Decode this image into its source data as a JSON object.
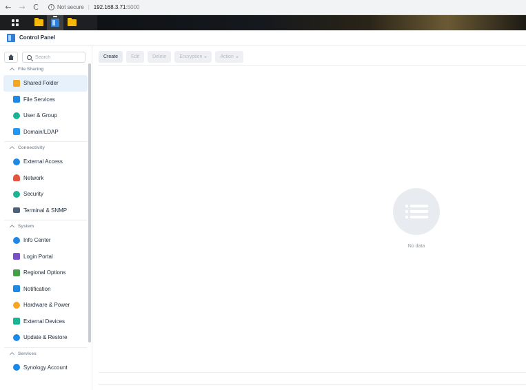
{
  "browser": {
    "back": "←",
    "forward": "→",
    "reload": "C",
    "security_label": "Not secure",
    "host": "192.168.3.71",
    "port": ":5000"
  },
  "window": {
    "title": "Control Panel"
  },
  "search": {
    "placeholder": "Search"
  },
  "sidebar": {
    "sections": [
      {
        "title": "File Sharing",
        "items": [
          {
            "label": "Shared Folder",
            "icon": "shared-folder-icon",
            "color": "#f5a623"
          },
          {
            "label": "File Services",
            "icon": "file-services-icon",
            "color": "#1e88e5"
          },
          {
            "label": "User & Group",
            "icon": "user-group-icon",
            "color": "#1ab394"
          },
          {
            "label": "Domain/LDAP",
            "icon": "domain-ldap-icon",
            "color": "#2196f3"
          }
        ]
      },
      {
        "title": "Connectivity",
        "items": [
          {
            "label": "External Access",
            "icon": "external-access-icon",
            "color": "#1e88e5"
          },
          {
            "label": "Network",
            "icon": "network-icon",
            "color": "#e8553f"
          },
          {
            "label": "Security",
            "icon": "security-icon",
            "color": "#1ab394"
          },
          {
            "label": "Terminal & SNMP",
            "icon": "terminal-icon",
            "color": "#4a6178"
          }
        ]
      },
      {
        "title": "System",
        "items": [
          {
            "label": "Info Center",
            "icon": "info-center-icon",
            "color": "#1e88e5"
          },
          {
            "label": "Login Portal",
            "icon": "login-portal-icon",
            "color": "#7b4fc9"
          },
          {
            "label": "Regional Options",
            "icon": "regional-options-icon",
            "color": "#43a047"
          },
          {
            "label": "Notification",
            "icon": "notification-icon",
            "color": "#1e88e5"
          },
          {
            "label": "Hardware & Power",
            "icon": "hardware-power-icon",
            "color": "#f5a623"
          },
          {
            "label": "External Devices",
            "icon": "external-devices-icon",
            "color": "#1ab394"
          },
          {
            "label": "Update & Restore",
            "icon": "update-restore-icon",
            "color": "#1e88e5"
          }
        ]
      },
      {
        "title": "Services",
        "items": [
          {
            "label": "Synology Account",
            "icon": "synology-account-icon",
            "color": "#1e88e5"
          }
        ]
      }
    ]
  },
  "toolbar": {
    "create": "Create",
    "edit": "Edit",
    "delete": "Delete",
    "encryption": "Encryption",
    "action": "Action"
  },
  "main": {
    "empty_text": "No data"
  },
  "colors": {
    "accent": "#2e7dd7",
    "selected_bg": "#e6f1fb",
    "section_text": "#8b97a4"
  }
}
